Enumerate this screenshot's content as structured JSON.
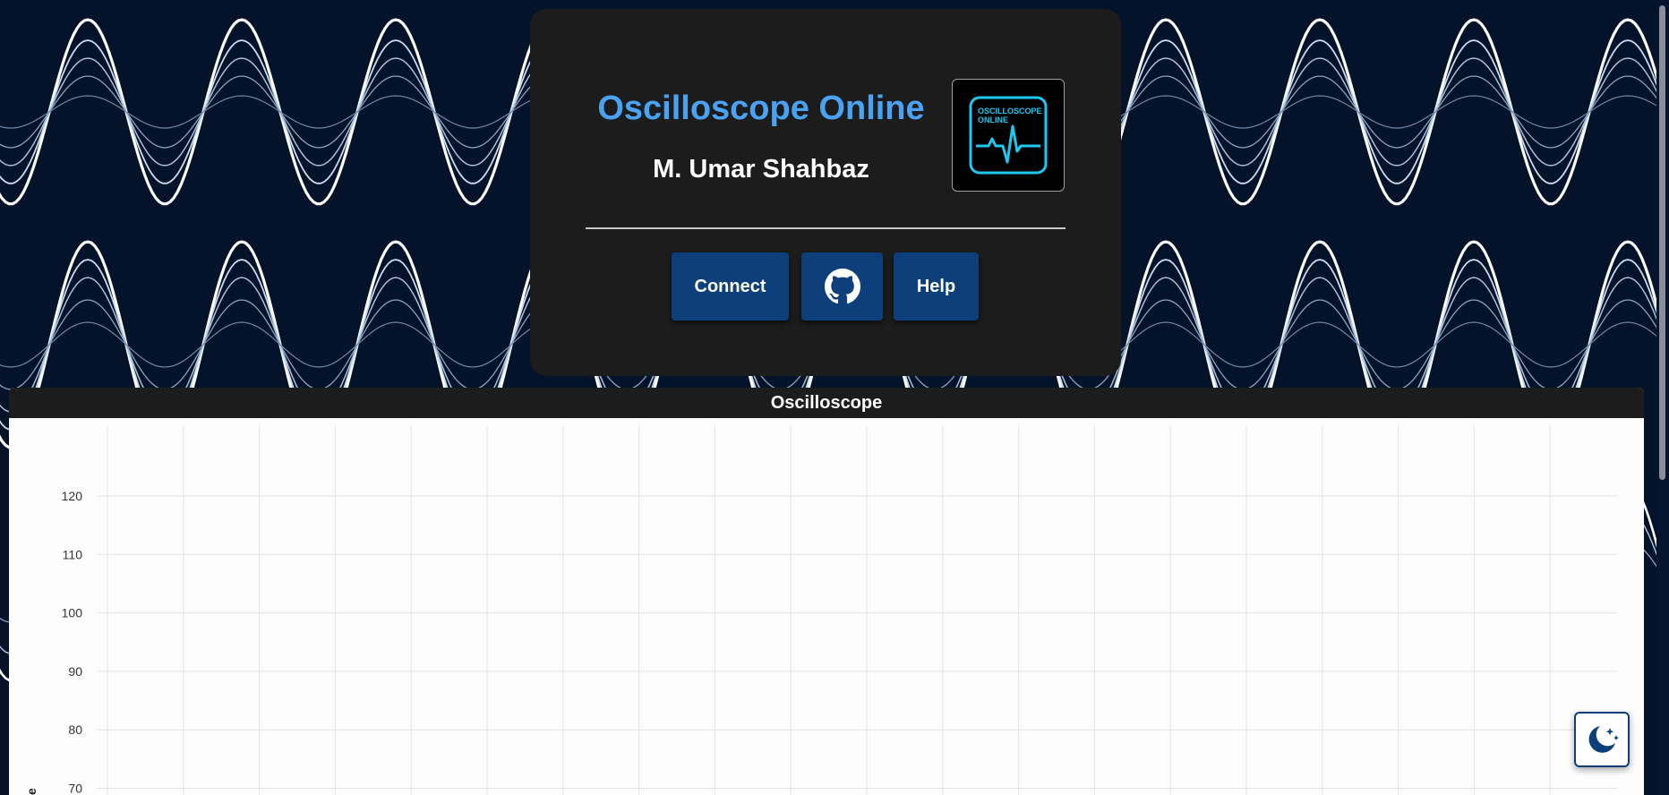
{
  "header": {
    "title": "Oscilloscope Online",
    "author": "M. Umar Shahbaz",
    "logo": {
      "line1": "OSCILLOSCOPE",
      "line2": "ONLINE",
      "icon": "oscilloscope-logo-icon"
    }
  },
  "buttons": {
    "connect_label": "Connect",
    "github_icon": "github-icon",
    "help_label": "Help"
  },
  "scope": {
    "title": "Oscilloscope",
    "ylabel_fragment": "e"
  },
  "theme_toggle": {
    "icon": "moon-stars-icon"
  },
  "colors": {
    "background": "#04122a",
    "card": "#1c1c1d",
    "accent": "#4aa3f2",
    "button": "#0d3f7a",
    "logo_cyan": "#1ec8f0"
  },
  "chart_data": {
    "type": "line",
    "series": [],
    "y_ticks": [
      120,
      110,
      100,
      90,
      80,
      70
    ],
    "ylim": [
      65,
      125
    ],
    "grid": true
  }
}
